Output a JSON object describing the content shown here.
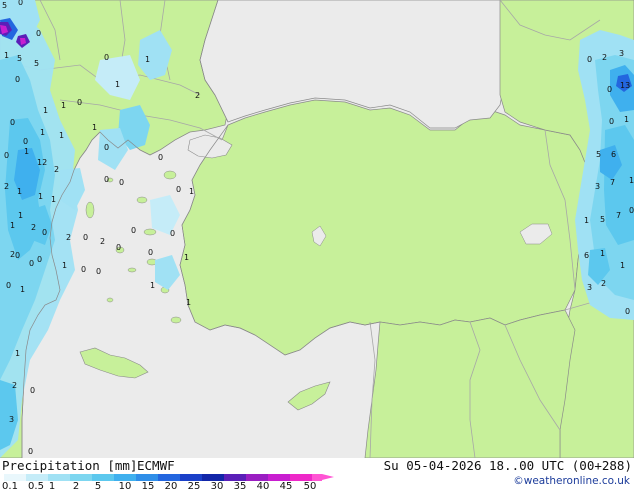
{
  "map": {
    "colors": {
      "sea": "#ebebeb",
      "land": "#c7f09a",
      "border": "#a7a7a7",
      "coast": "#8a8a8a"
    },
    "values": [
      {
        "t": "0",
        "k": "a"
      },
      {
        "t": "5",
        "k": "b"
      },
      {
        "t": "0",
        "k": "c"
      },
      {
        "t": "1",
        "k": "d"
      },
      {
        "t": "5",
        "k": "e"
      },
      {
        "t": "0",
        "k": "f"
      },
      {
        "t": "5",
        "k": "g"
      },
      {
        "t": "1",
        "k": "h"
      },
      {
        "t": "1",
        "k": "i"
      },
      {
        "t": "0",
        "k": "j"
      },
      {
        "t": "1",
        "k": "k"
      },
      {
        "t": "1",
        "k": "l"
      },
      {
        "t": "0",
        "k": "m"
      },
      {
        "t": "1",
        "k": "n"
      },
      {
        "t": "1",
        "k": "o"
      },
      {
        "t": "0",
        "k": "p"
      },
      {
        "t": "2",
        "k": "q"
      },
      {
        "t": "12",
        "k": "r"
      },
      {
        "t": "2",
        "k": "s"
      },
      {
        "t": "1",
        "k": "t"
      },
      {
        "t": "0",
        "k": "u"
      },
      {
        "t": "0",
        "k": "v"
      },
      {
        "t": "0",
        "k": "w"
      },
      {
        "t": "1",
        "k": "x"
      },
      {
        "t": "1",
        "k": "y"
      },
      {
        "t": "1",
        "k": "z"
      },
      {
        "t": "2",
        "k": "aa"
      },
      {
        "t": "1",
        "k": "ab"
      },
      {
        "t": "2",
        "k": "ac"
      },
      {
        "t": "1",
        "k": "ad"
      },
      {
        "t": "0",
        "k": "ae"
      },
      {
        "t": "0",
        "k": "af"
      },
      {
        "t": "2",
        "k": "ag"
      },
      {
        "t": "2",
        "k": "ah"
      },
      {
        "t": "2",
        "k": "ai"
      },
      {
        "t": "0",
        "k": "aj"
      },
      {
        "t": "0",
        "k": "ak"
      },
      {
        "t": "1",
        "k": "al"
      },
      {
        "t": "0",
        "k": "am"
      },
      {
        "t": "0",
        "k": "an"
      },
      {
        "t": "0",
        "k": "ao"
      },
      {
        "t": "1",
        "k": "ap"
      },
      {
        "t": "0",
        "k": "aq"
      },
      {
        "t": "1",
        "k": "ar"
      },
      {
        "t": "0",
        "k": "as"
      },
      {
        "t": "1",
        "k": "at"
      },
      {
        "t": "0",
        "k": "au"
      },
      {
        "t": "0",
        "k": "av"
      },
      {
        "t": "0",
        "k": "aw"
      },
      {
        "t": "0",
        "k": "ax"
      },
      {
        "t": "1",
        "k": "ay"
      },
      {
        "t": "0",
        "k": "az"
      },
      {
        "t": "0",
        "k": "ba"
      },
      {
        "t": "0",
        "k": "bb"
      },
      {
        "t": "1",
        "k": "bc"
      },
      {
        "t": "2",
        "k": "bd"
      },
      {
        "t": "0",
        "k": "be"
      },
      {
        "t": "3",
        "k": "bf"
      },
      {
        "t": "0",
        "k": "bg"
      },
      {
        "t": "0",
        "k": "bh"
      },
      {
        "t": "2",
        "k": "bi"
      },
      {
        "t": "3",
        "k": "bj"
      },
      {
        "t": "13",
        "k": "bk"
      },
      {
        "t": "0",
        "k": "bl"
      },
      {
        "t": "0",
        "k": "bm"
      },
      {
        "t": "1",
        "k": "bn"
      },
      {
        "t": "5",
        "k": "bo"
      },
      {
        "t": "6",
        "k": "bp"
      },
      {
        "t": "3",
        "k": "bq"
      },
      {
        "t": "7",
        "k": "br"
      },
      {
        "t": "1",
        "k": "bs"
      },
      {
        "t": "5",
        "k": "bt"
      },
      {
        "t": "7",
        "k": "bu"
      },
      {
        "t": "0",
        "k": "bv"
      },
      {
        "t": "1",
        "k": "bw"
      },
      {
        "t": "6",
        "k": "bx"
      },
      {
        "t": "1",
        "k": "by"
      },
      {
        "t": "1",
        "k": "bz"
      },
      {
        "t": "3",
        "k": "ca"
      },
      {
        "t": "2",
        "k": "cb"
      },
      {
        "t": "0",
        "k": "cc"
      },
      {
        "t": "1",
        "k": "cd"
      },
      {
        "t": "1",
        "k": "ce"
      }
    ]
  },
  "legend": {
    "title": "Precipitation [mm]",
    "model": "ECMWF",
    "run": "Su 05-04-2026 18..00 UTC (00+288)",
    "credit": "©weatheronline.co.uk",
    "ticks": [
      "0.1",
      "0.5",
      "1",
      "2",
      "5",
      "10",
      "15",
      "20",
      "25",
      "30",
      "35",
      "40",
      "45",
      "50"
    ],
    "colors": [
      "#e9f7fc",
      "#c5ecf8",
      "#a0e1f4",
      "#7dd6f0",
      "#5cc8ee",
      "#3fb0ee",
      "#2f8ee8",
      "#2366df",
      "#1a40c8",
      "#1226a8",
      "#5a1fb8",
      "#9a1ec2",
      "#c81ed0",
      "#ee28c8",
      "#ff55d4"
    ]
  }
}
